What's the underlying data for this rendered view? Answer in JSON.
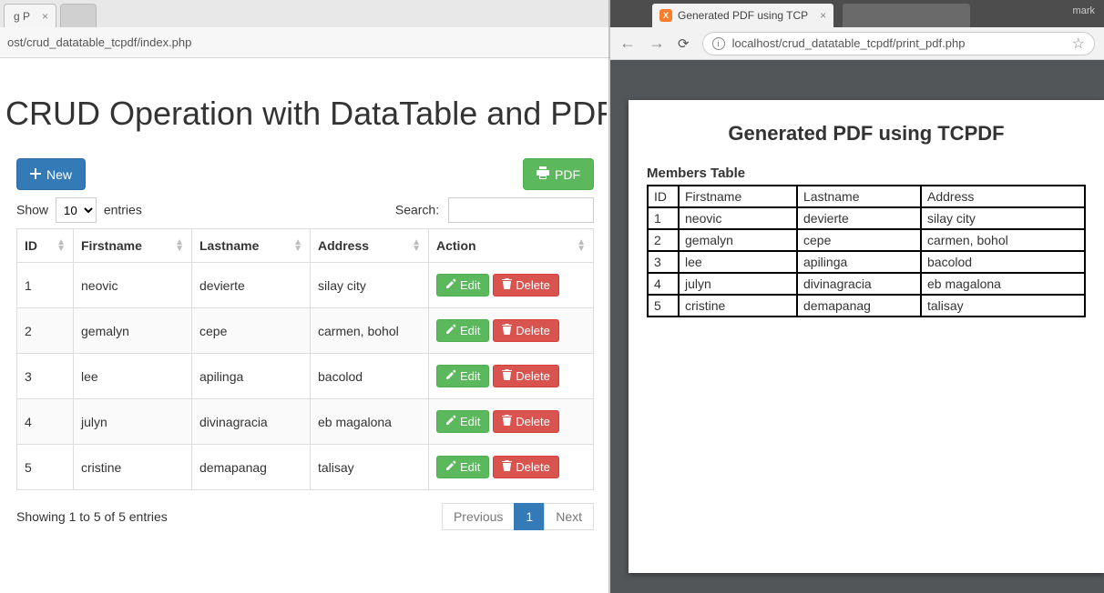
{
  "left": {
    "tab_title": "g P",
    "url": "ost/crud_datatable_tcpdf/index.php",
    "heading": "CRUD Operation with DataTable and PDF",
    "new_btn": "New",
    "pdf_btn": "PDF",
    "dt": {
      "show": "Show",
      "entries": "entries",
      "length_value": "10",
      "search_label": "Search:",
      "columns": [
        "ID",
        "Firstname",
        "Lastname",
        "Address",
        "Action"
      ],
      "rows": [
        {
          "id": "1",
          "first": "neovic",
          "last": "devierte",
          "addr": "silay city"
        },
        {
          "id": "2",
          "first": "gemalyn",
          "last": "cepe",
          "addr": "carmen, bohol"
        },
        {
          "id": "3",
          "first": "lee",
          "last": "apilinga",
          "addr": "bacolod"
        },
        {
          "id": "4",
          "first": "julyn",
          "last": "divinagracia",
          "addr": "eb magalona"
        },
        {
          "id": "5",
          "first": "cristine",
          "last": "demapanag",
          "addr": "talisay"
        }
      ],
      "edit_label": "Edit",
      "delete_label": "Delete",
      "info": "Showing 1 to 5 of 5 entries",
      "prev": "Previous",
      "page": "1",
      "next": "Next"
    }
  },
  "right": {
    "profile": "mark",
    "tab_title": "Generated PDF using TCP",
    "url": "localhost/crud_datatable_tcpdf/print_pdf.php",
    "pdf": {
      "title": "Generated PDF using TCPDF",
      "subtitle": "Members Table",
      "columns": [
        "ID",
        "Firstname",
        "Lastname",
        "Address"
      ],
      "rows": [
        {
          "id": "1",
          "first": "neovic",
          "last": "devierte",
          "addr": "silay city"
        },
        {
          "id": "2",
          "first": "gemalyn",
          "last": "cepe",
          "addr": "carmen, bohol"
        },
        {
          "id": "3",
          "first": "lee",
          "last": "apilinga",
          "addr": "bacolod"
        },
        {
          "id": "4",
          "first": "julyn",
          "last": "divinagracia",
          "addr": "eb magalona"
        },
        {
          "id": "5",
          "first": "cristine",
          "last": "demapanag",
          "addr": "talisay"
        }
      ]
    }
  }
}
